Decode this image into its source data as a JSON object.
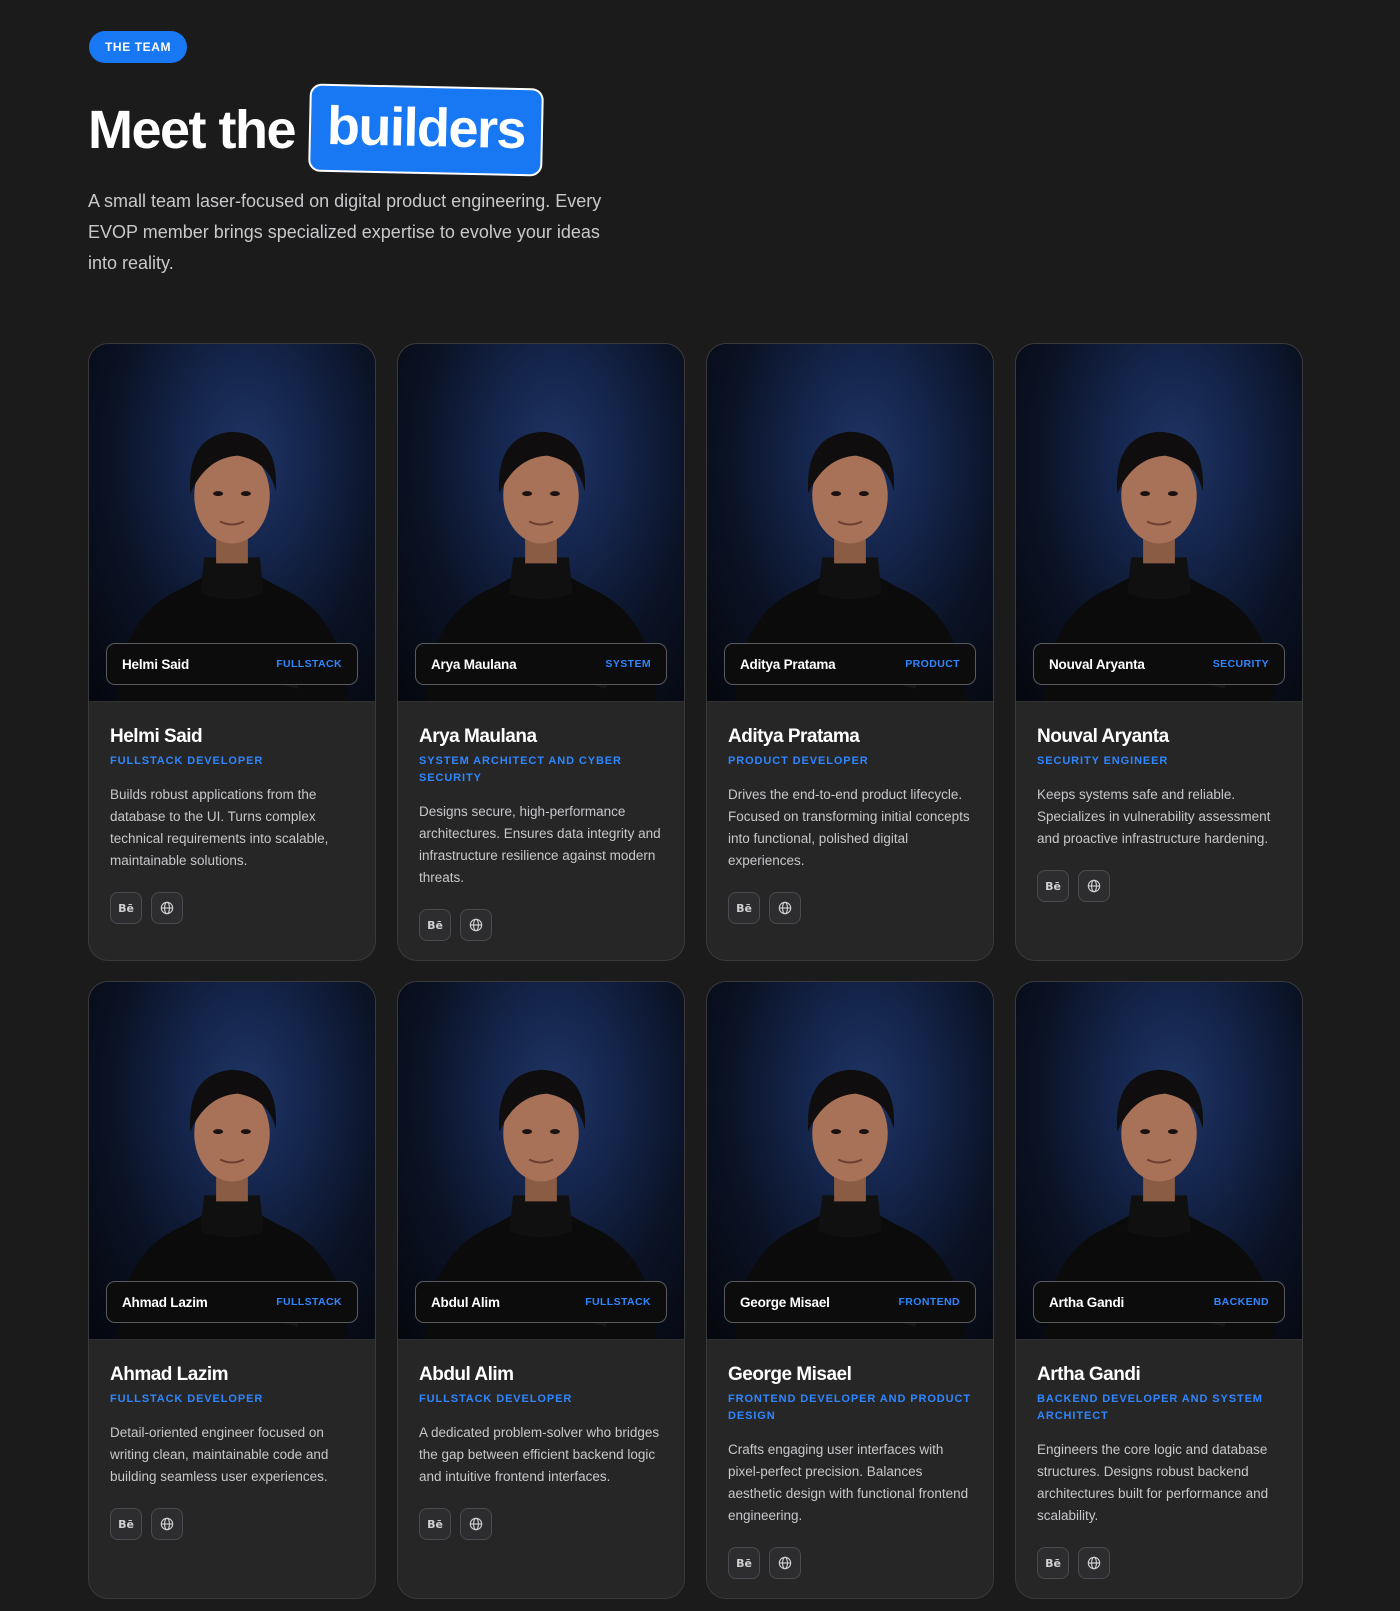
{
  "section": {
    "badge": "THE TEAM",
    "headline_plain": "Meet the",
    "headline_highlight": "builders",
    "intro": "A small team laser-focused on digital product engineering. Every EVOP member brings specialized expertise to evolve your ideas into reality."
  },
  "colors": {
    "accent": "#1877f2",
    "background": "#1b1b1c",
    "card": "#262627"
  },
  "members": [
    {
      "name": "Helmi Said",
      "tag": "FULLSTACK",
      "role": "FULLSTACK DEVELOPER",
      "description": "Builds robust applications from the database to the UI. Turns complex technical requirements into scalable, maintainable solutions.",
      "icons": [
        "behance-icon",
        "globe-icon"
      ]
    },
    {
      "name": "Arya Maulana",
      "tag": "SYSTEM",
      "role": "SYSTEM ARCHITECT AND CYBER SECURITY",
      "description": "Designs secure, high-performance architectures. Ensures data integrity and infrastructure resilience against modern threats.",
      "icons": [
        "behance-icon",
        "globe-icon"
      ]
    },
    {
      "name": "Aditya Pratama",
      "tag": "PRODUCT",
      "role": "PRODUCT DEVELOPER",
      "description": "Drives the end-to-end product lifecycle. Focused on transforming initial concepts into functional, polished digital experiences.",
      "icons": [
        "behance-icon",
        "globe-icon"
      ]
    },
    {
      "name": "Nouval Aryanta",
      "tag": "SECURITY",
      "role": "SECURITY ENGINEER",
      "description": "Keeps systems safe and reliable. Specializes in vulnerability assessment and proactive infrastructure hardening.",
      "icons": [
        "behance-icon",
        "globe-icon"
      ]
    },
    {
      "name": "Ahmad Lazim",
      "tag": "FULLSTACK",
      "role": "FULLSTACK DEVELOPER",
      "description": "Detail-oriented engineer focused on writing clean, maintainable code and building seamless user experiences.",
      "icons": [
        "behance-icon",
        "globe-icon"
      ]
    },
    {
      "name": "Abdul Alim",
      "tag": "FULLSTACK",
      "role": "FULLSTACK DEVELOPER",
      "description": "A dedicated problem-solver who bridges the gap between efficient backend logic and intuitive frontend interfaces.",
      "icons": [
        "behance-icon",
        "globe-icon"
      ]
    },
    {
      "name": "George Misael",
      "tag": "FRONTEND",
      "role": "FRONTEND DEVELOPER AND PRODUCT DESIGN",
      "description": "Crafts engaging user interfaces with pixel-perfect precision. Balances aesthetic design with functional frontend engineering.",
      "icons": [
        "behance-icon",
        "globe-icon"
      ]
    },
    {
      "name": "Artha Gandi",
      "tag": "BACKEND",
      "role": "BACKEND DEVELOPER AND SYSTEM ARCHITECT",
      "description": "Engineers the core logic and database structures. Designs robust backend architectures built for performance and scalability.",
      "icons": [
        "behance-icon",
        "globe-icon"
      ]
    }
  ]
}
